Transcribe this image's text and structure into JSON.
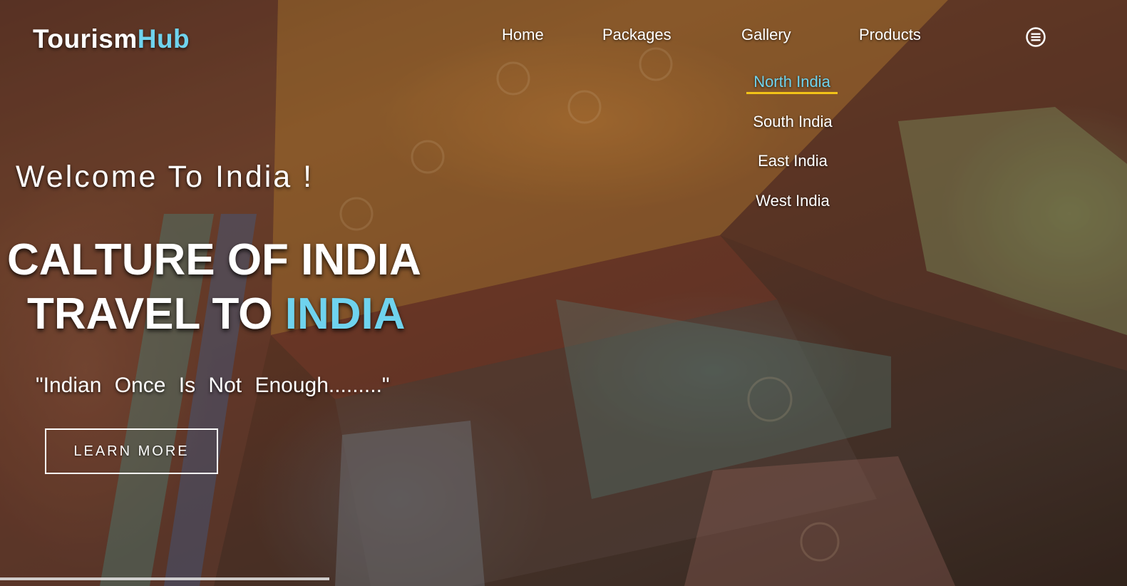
{
  "header": {
    "logo_main": "Tourism",
    "logo_accent": "Hub",
    "nav": {
      "home": "Home",
      "packages": "Packages",
      "gallery": "Gallery",
      "products": "Products"
    },
    "menu_icon": "hamburger-circle-icon"
  },
  "dropdown": {
    "items": [
      "North India",
      "South India",
      "East India",
      "West India"
    ],
    "active_index": 0
  },
  "hero": {
    "welcome": "Welcome To India !",
    "line1": "CALTURE OF INDIA",
    "line2_prefix": "TRAVEL TO ",
    "line2_accent": "INDIA",
    "quote": "\"Indian Once Is Not Enough.........\"",
    "button_label": "LEARN MORE"
  },
  "colors": {
    "accent": "#6fd3ee",
    "underline": "#f2c318",
    "text": "#ffffff"
  }
}
